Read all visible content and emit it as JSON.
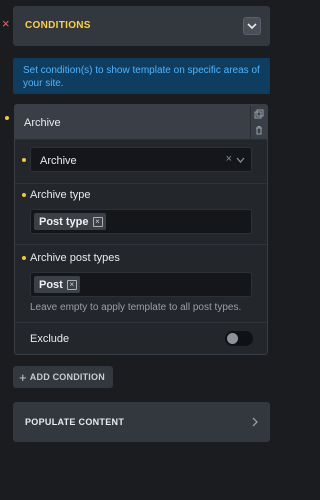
{
  "conditions": {
    "title": "CONDITIONS",
    "info": "Set condition(s) to show template on specific areas of your site."
  },
  "condition_card": {
    "title": "Archive",
    "select_value": "Archive",
    "clear_glyph": "×",
    "archive_type_label": "Archive type",
    "archive_type_tag": "Post type",
    "post_types_label": "Archive post types",
    "post_types_tag": "Post",
    "help_text": "Leave empty to apply template to all post types.",
    "exclude_label": "Exclude",
    "exclude_enabled": false
  },
  "tag_remove_glyph": "×",
  "remove_glyph": "×",
  "add_condition_label": "ADD CONDITION",
  "add_plus": "+",
  "populate": {
    "title": "POPULATE CONTENT"
  },
  "colors": {
    "accent_yellow": "#ffcf4a",
    "info_text": "#4fb4ff",
    "info_bg": "#0e3d5f",
    "remove_red": "#e06a6a"
  }
}
